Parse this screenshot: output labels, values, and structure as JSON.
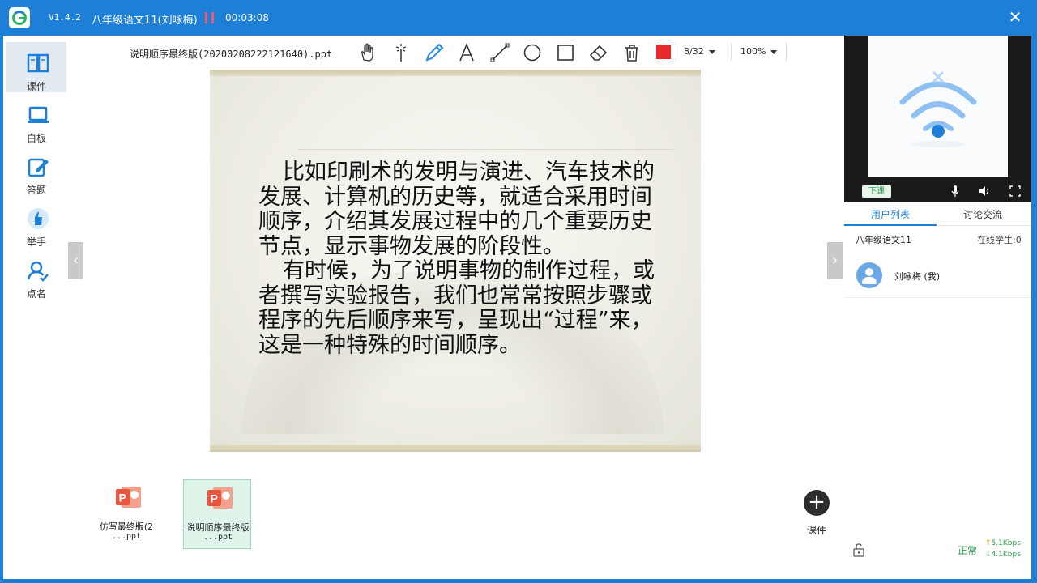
{
  "titlebar": {
    "version": "V1.4.2",
    "course_title": "八年级语文11(刘咏梅)",
    "timer": "00:03:08",
    "close_glyph": "✕"
  },
  "sidebar": {
    "items": [
      {
        "label": "课件",
        "icon": "book-icon",
        "active": true
      },
      {
        "label": "白板",
        "icon": "laptop-icon"
      },
      {
        "label": "答题",
        "icon": "edit-icon"
      },
      {
        "label": "举手",
        "icon": "raise-hand-icon"
      },
      {
        "label": "点名",
        "icon": "roll-call-icon"
      }
    ]
  },
  "toolbar": {
    "file_name": "说明顺序最终版(20200208222121640).ppt",
    "tools": [
      "hand-icon",
      "laser-pointer-icon",
      "pen-icon",
      "text-icon",
      "line-icon",
      "circle-icon",
      "rectangle-icon",
      "eraser-icon",
      "trash-icon"
    ],
    "pen_color": "#e8282d",
    "page": "8/32",
    "zoom": "100%"
  },
  "slide": {
    "paragraph1": "比如印刷术的发明与演进、汽车技术的发展、计算机的历史等，就适合采用时间顺序，介绍其发展过程中的几个重要历史节点，显示事物发展的阶段性。",
    "paragraph2": "有时候，为了说明事物的制作过程，或者撰写实验报告，我们也常常按照步骤或程序的先后顺序来写，呈现出“过程”来，这是一种特殊的时间顺序。"
  },
  "thumbnails": [
    {
      "line1": "仿写最终版(2",
      "line2": "...ppt",
      "selected": false
    },
    {
      "line1": "说明顺序最终版",
      "line2": "...ppt",
      "selected": true
    }
  ],
  "add_courseware_label": "课件",
  "video": {
    "end_class_label": "下课"
  },
  "right_panel": {
    "tabs": [
      "用户列表",
      "讨论交流"
    ],
    "class_name": "八年级语文11",
    "online_count": "在线学生:0",
    "user_name": "刘咏梅 (我)",
    "net_status": "正常",
    "upload_speed": "5.1Kbps",
    "download_speed": "4.1Kbps"
  },
  "colors": {
    "brand_blue": "#1e7fd6",
    "accent_green": "#2a9d4b",
    "ppt_orange": "#e8563d"
  }
}
